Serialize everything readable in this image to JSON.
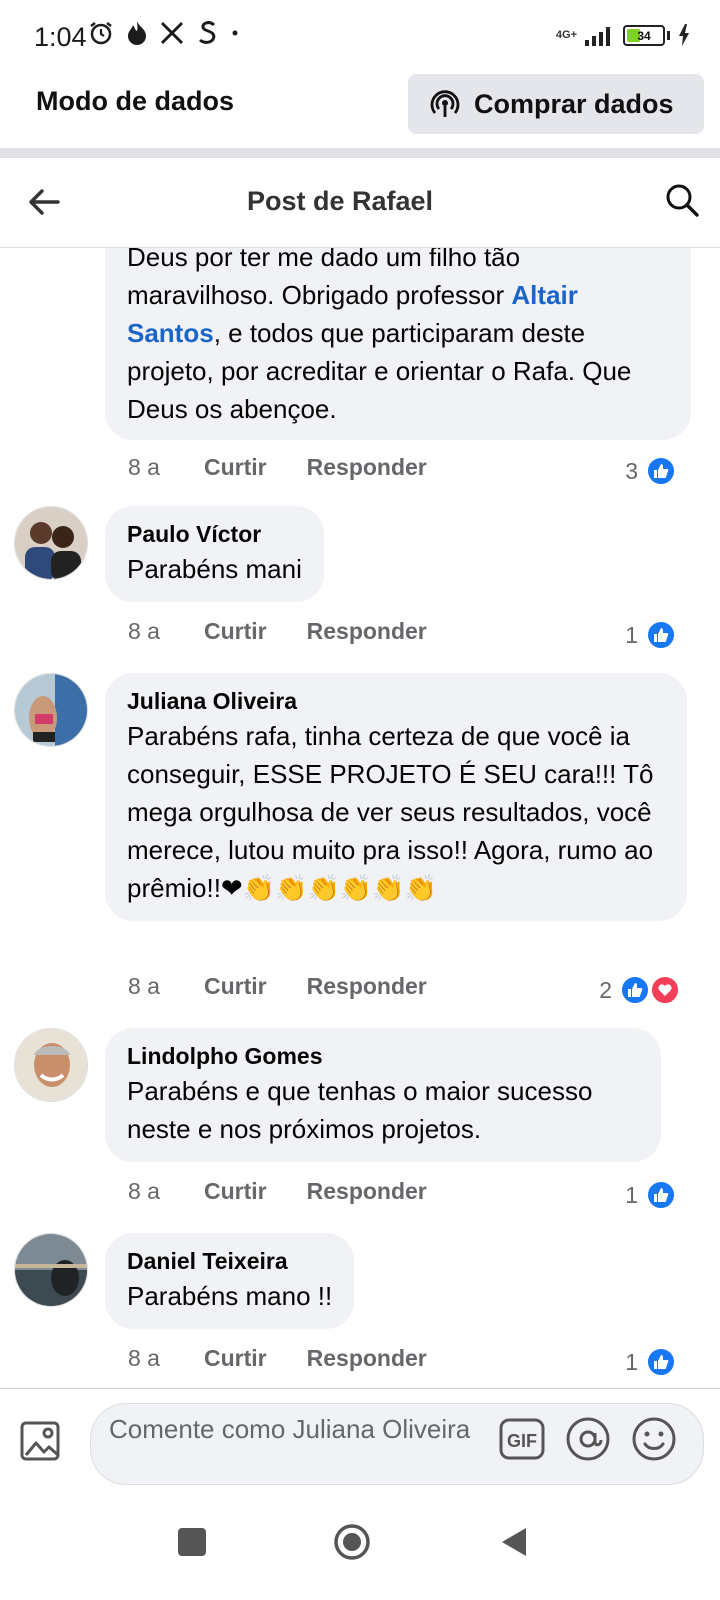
{
  "status_bar": {
    "time": "1:04",
    "notification_icons": [
      "alarm-icon",
      "fire-icon",
      "x-icon",
      "s-icon"
    ],
    "network": "4G+",
    "battery": "34",
    "battery_level": 0.34
  },
  "data_banner": {
    "title": "Modo de dados",
    "buy_button": "Comprar dados"
  },
  "header": {
    "title": "Post de Rafael"
  },
  "comments": [
    {
      "text_before": "Deus por ter me dado um filho tão maravilhoso. Obrigado professor ",
      "mention": "Altair Santos",
      "text_after": ", e todos que participaram deste projeto, por acreditar e orientar o Rafa. Que Deus os abençoe.",
      "time": "8 a",
      "like_label": "Curtir",
      "reply_label": "Responder",
      "reactions": "3"
    },
    {
      "author": "Paulo Víctor",
      "text": "Parabéns mani",
      "time": "8 a",
      "like_label": "Curtir",
      "reply_label": "Responder",
      "reactions": "1"
    },
    {
      "author": "Juliana Oliveira",
      "text": "Parabéns rafa, tinha certeza de que você ia conseguir, ESSE PROJETO É SEU cara!!! Tô mega orgulhosa de ver seus resultados, você merece, lutou muito pra isso!! Agora, rumo ao prêmio!!❤👏👏👏👏👏👏",
      "time": "8 a",
      "like_label": "Curtir",
      "reply_label": "Responder",
      "reactions": "2"
    },
    {
      "author": "Lindolpho Gomes",
      "text": "Parabéns e que tenhas o maior sucesso neste e nos próximos projetos.",
      "time": "8 a",
      "like_label": "Curtir",
      "reply_label": "Responder",
      "reactions": "1"
    },
    {
      "author": "Daniel Teixeira",
      "text": "Parabéns mano !!",
      "time": "8 a",
      "like_label": "Curtir",
      "reply_label": "Responder",
      "reactions": "1"
    }
  ],
  "composer": {
    "placeholder": "Comente como Juliana Oliveira",
    "gif_label": "GIF"
  },
  "colors": {
    "accent": "#1877f2",
    "mention": "#1b64c8",
    "bubble": "#f0f2f5",
    "love": "#f33e58"
  }
}
